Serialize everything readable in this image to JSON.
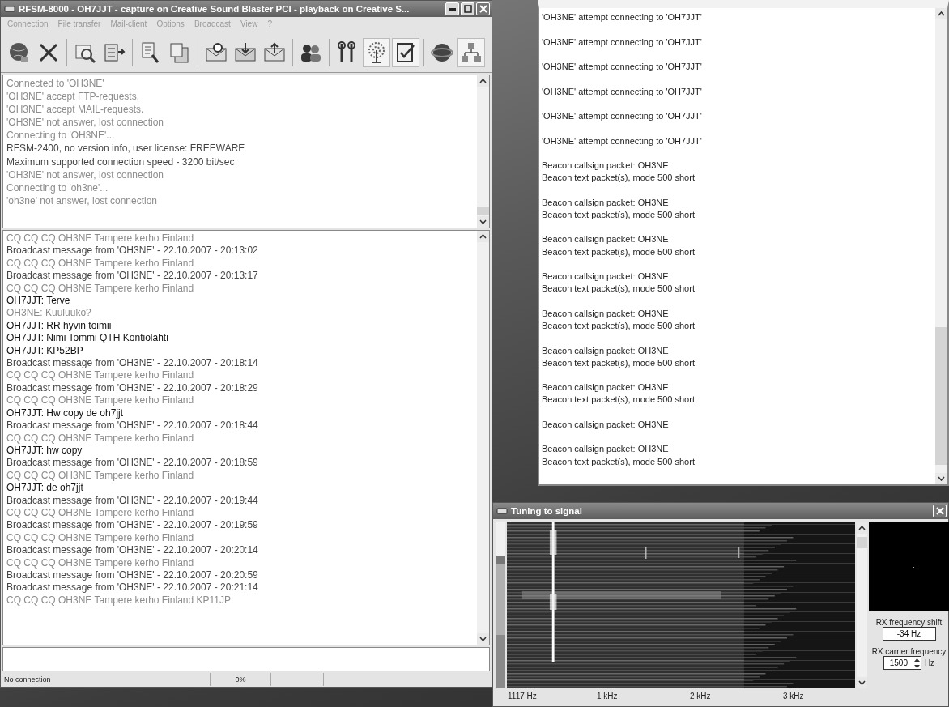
{
  "main_window": {
    "title": "RFSM-8000 - OH7JJT - capture on Creative Sound Blaster PCI - playback on Creative S...",
    "menu": [
      "Connection",
      "File transfer",
      "Mail-client",
      "Options",
      "Broadcast",
      "View",
      "?"
    ],
    "toolbar": [
      {
        "pressed": false
      },
      {
        "pressed": false
      },
      {
        "pressed": false
      },
      {
        "pressed": false
      },
      {
        "pressed": false
      },
      {
        "pressed": false
      },
      {
        "pressed": false
      },
      {
        "pressed": false
      },
      {
        "pressed": false
      },
      {
        "pressed": false
      },
      {
        "pressed": false
      },
      {
        "pressed": true
      },
      {
        "pressed": true
      },
      {
        "pressed": false
      },
      {
        "pressed": true
      }
    ],
    "log": [
      {
        "text": "Connected to 'OH3NE'",
        "kind": "dim"
      },
      {
        "text": "'OH3NE' accept FTP-requests.",
        "kind": "dim"
      },
      {
        "text": "'OH3NE' accept MAIL-requests.",
        "kind": "dim"
      },
      {
        "text": "'OH3NE' not answer, lost connection",
        "kind": "dim"
      },
      {
        "text": "Connecting to 'OH3NE'...",
        "kind": "dim"
      },
      {
        "text": "RFSM-2400, no version info, user license: FREEWARE",
        "kind": "normal"
      },
      {
        "text": "Maximum supported connection speed - 3200 bit/sec",
        "kind": "normal"
      },
      {
        "text": "'OH3NE' not answer, lost connection",
        "kind": "dim"
      },
      {
        "text": "Connecting to 'oh3ne'...",
        "kind": "dim"
      },
      {
        "text": "'oh3ne' not answer, lost connection",
        "kind": "dim"
      }
    ],
    "chat": [
      {
        "text": "CQ CQ CQ OH3NE Tampere kerho Finland",
        "kind": "dim"
      },
      {
        "text": "Broadcast message from 'OH3NE' - 22.10.2007 - 20:13:02",
        "kind": "normal"
      },
      {
        "text": "CQ CQ CQ OH3NE Tampere kerho Finland",
        "kind": "dim"
      },
      {
        "text": "Broadcast message from 'OH3NE' - 22.10.2007 - 20:13:17",
        "kind": "normal"
      },
      {
        "text": "CQ CQ CQ OH3NE Tampere kerho Finland",
        "kind": "dim"
      },
      {
        "text": "OH7JJT: Terve",
        "kind": "strong"
      },
      {
        "text": "OH3NE: Kuuluuko?",
        "kind": "dim"
      },
      {
        "text": "OH7JJT: RR hyvin toimii",
        "kind": "strong"
      },
      {
        "text": "OH7JJT: Nimi Tommi QTH Kontiolahti",
        "kind": "strong"
      },
      {
        "text": "OH7JJT: KP52BP",
        "kind": "strong"
      },
      {
        "text": "Broadcast message from 'OH3NE' - 22.10.2007 - 20:18:14",
        "kind": "normal"
      },
      {
        "text": "CQ CQ CQ OH3NE Tampere kerho Finland",
        "kind": "dim"
      },
      {
        "text": "Broadcast message from 'OH3NE' - 22.10.2007 - 20:18:29",
        "kind": "normal"
      },
      {
        "text": "CQ CQ CQ OH3NE Tampere kerho Finland",
        "kind": "dim"
      },
      {
        "text": "OH7JJT: Hw copy de oh7jjt",
        "kind": "strong"
      },
      {
        "text": "Broadcast message from 'OH3NE' - 22.10.2007 - 20:18:44",
        "kind": "normal"
      },
      {
        "text": "CQ CQ CQ OH3NE Tampere kerho Finland",
        "kind": "dim"
      },
      {
        "text": "OH7JJT: hw copy",
        "kind": "strong"
      },
      {
        "text": "Broadcast message from 'OH3NE' - 22.10.2007 - 20:18:59",
        "kind": "normal"
      },
      {
        "text": "CQ CQ CQ OH3NE Tampere kerho Finland",
        "kind": "dim"
      },
      {
        "text": "OH7JJT: de oh7jjt",
        "kind": "strong"
      },
      {
        "text": "Broadcast message from 'OH3NE' - 22.10.2007 - 20:19:44",
        "kind": "normal"
      },
      {
        "text": "CQ CQ CQ OH3NE Tampere kerho Finland",
        "kind": "dim"
      },
      {
        "text": "Broadcast message from 'OH3NE' - 22.10.2007 - 20:19:59",
        "kind": "normal"
      },
      {
        "text": "CQ CQ CQ OH3NE Tampere kerho Finland",
        "kind": "dim"
      },
      {
        "text": "Broadcast message from 'OH3NE' - 22.10.2007 - 20:20:14",
        "kind": "normal"
      },
      {
        "text": "CQ CQ CQ OH3NE Tampere kerho Finland",
        "kind": "dim"
      },
      {
        "text": "Broadcast message from 'OH3NE' - 22.10.2007 - 20:20:59",
        "kind": "normal"
      },
      {
        "text": "Broadcast message from 'OH3NE' - 22.10.2007 - 20:21:14",
        "kind": "normal"
      },
      {
        "text": "CQ CQ CQ OH3NE Tampere kerho Finland KP11JP",
        "kind": "dim"
      }
    ],
    "status_bar": [
      "No connection",
      "0%"
    ]
  },
  "packet_window": {
    "entries": [
      [
        "'OH3NE' attempt connecting to 'OH7JJT'"
      ],
      [
        "'OH3NE' attempt connecting to 'OH7JJT'"
      ],
      [
        "'OH3NE' attempt connecting to 'OH7JJT'"
      ],
      [
        "'OH3NE' attempt connecting to 'OH7JJT'"
      ],
      [
        "'OH3NE' attempt connecting to 'OH7JJT'"
      ],
      [
        "'OH3NE' attempt connecting to 'OH7JJT'"
      ],
      [
        "Beacon callsign packet: OH3NE",
        "Beacon text packet(s), mode 500 short"
      ],
      [
        "Beacon callsign packet: OH3NE",
        "Beacon text packet(s), mode 500 short"
      ],
      [
        "Beacon callsign packet: OH3NE",
        "Beacon text packet(s), mode 500 short"
      ],
      [
        "Beacon callsign packet: OH3NE",
        "Beacon text packet(s), mode 500 short"
      ],
      [
        "Beacon callsign packet: OH3NE",
        "Beacon text packet(s), mode 500 short"
      ],
      [
        "Beacon callsign packet: OH3NE",
        "Beacon text packet(s), mode 500 short"
      ],
      [
        "Beacon callsign packet: OH3NE",
        "Beacon text packet(s), mode 500 short"
      ],
      [
        "Beacon callsign packet: OH3NE"
      ],
      [
        "Beacon callsign packet: OH3NE",
        "Beacon text packet(s), mode 500 short"
      ]
    ]
  },
  "tuning_window": {
    "title": "Tuning to signal",
    "signal_meter": {
      "level": 0.8
    },
    "axis_labels": [
      "1117 Hz",
      "1 kHz",
      "2 kHz",
      "3 kHz"
    ],
    "rx_shift": {
      "label": "RX frequency shift",
      "value": "-34 Hz"
    },
    "rx_carrier": {
      "label": "RX carrier frequency",
      "value": "1500",
      "unit": "Hz"
    }
  }
}
